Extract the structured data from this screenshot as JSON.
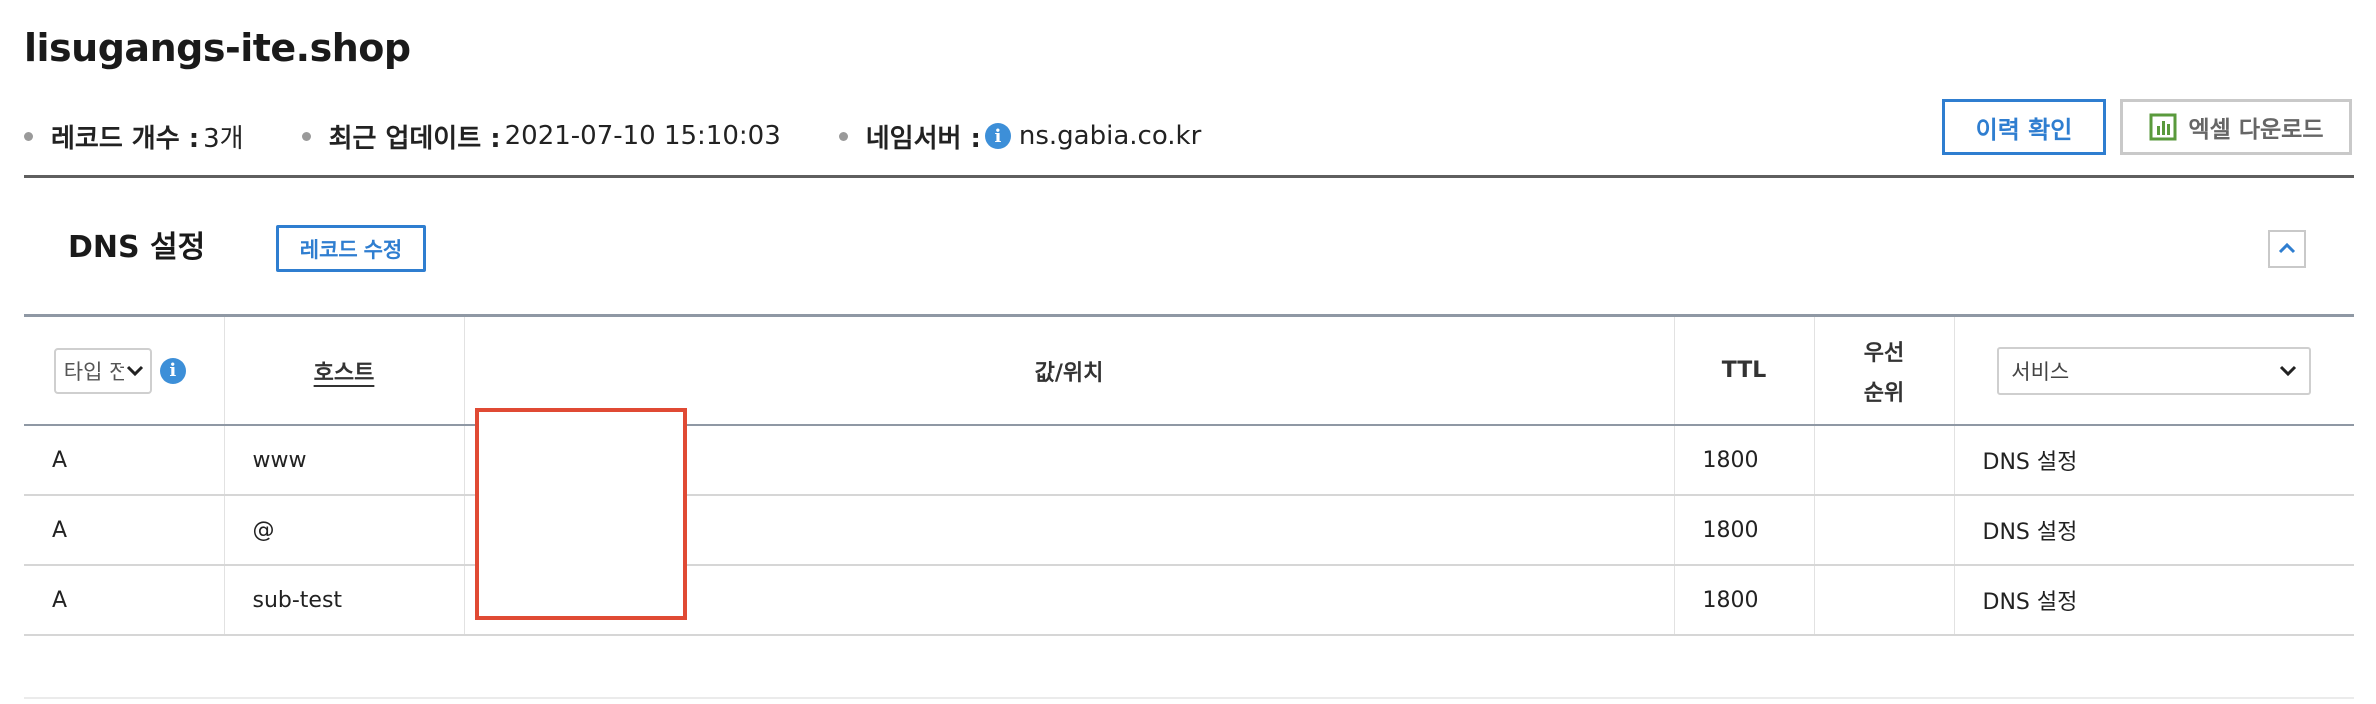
{
  "header": {
    "domain": "lisugangs-ite.shop",
    "record_count_label": "레코드 개수 :",
    "record_count_value": "3개",
    "updated_label": "최근 업데이트 :",
    "updated_value": "2021-07-10 15:10:03",
    "nameserver_label": "네임서버 :",
    "nameserver_value": "ns.gabia.co.kr",
    "history_button": "이력 확인",
    "excel_button": "엑셀 다운로드"
  },
  "section": {
    "title": "DNS 설정",
    "edit_button": "레코드 수정"
  },
  "table": {
    "type_filter": "타입 전체",
    "columns": {
      "host": "호스트",
      "value": "값/위치",
      "ttl": "TTL",
      "priority_line1": "우선",
      "priority_line2": "순위"
    },
    "service_filter": "서비스",
    "rows": [
      {
        "type": "A",
        "host": "www",
        "value": "",
        "ttl": "1800",
        "priority": "",
        "service": "DNS 설정"
      },
      {
        "type": "A",
        "host": "@",
        "value": "",
        "ttl": "1800",
        "priority": "",
        "service": "DNS 설정"
      },
      {
        "type": "A",
        "host": "sub-test",
        "value": "",
        "ttl": "1800",
        "priority": "",
        "service": "DNS 설정"
      }
    ]
  },
  "colors": {
    "accent": "#2f7ed0",
    "info_icon": "#3d8fd8",
    "redaction_border": "#e04a34",
    "excel_icon": "#5a9a3c"
  },
  "icons": {
    "info": "info-icon",
    "excel": "spreadsheet-icon",
    "collapse": "chevron-up-icon",
    "dropdown": "chevron-down-icon"
  }
}
